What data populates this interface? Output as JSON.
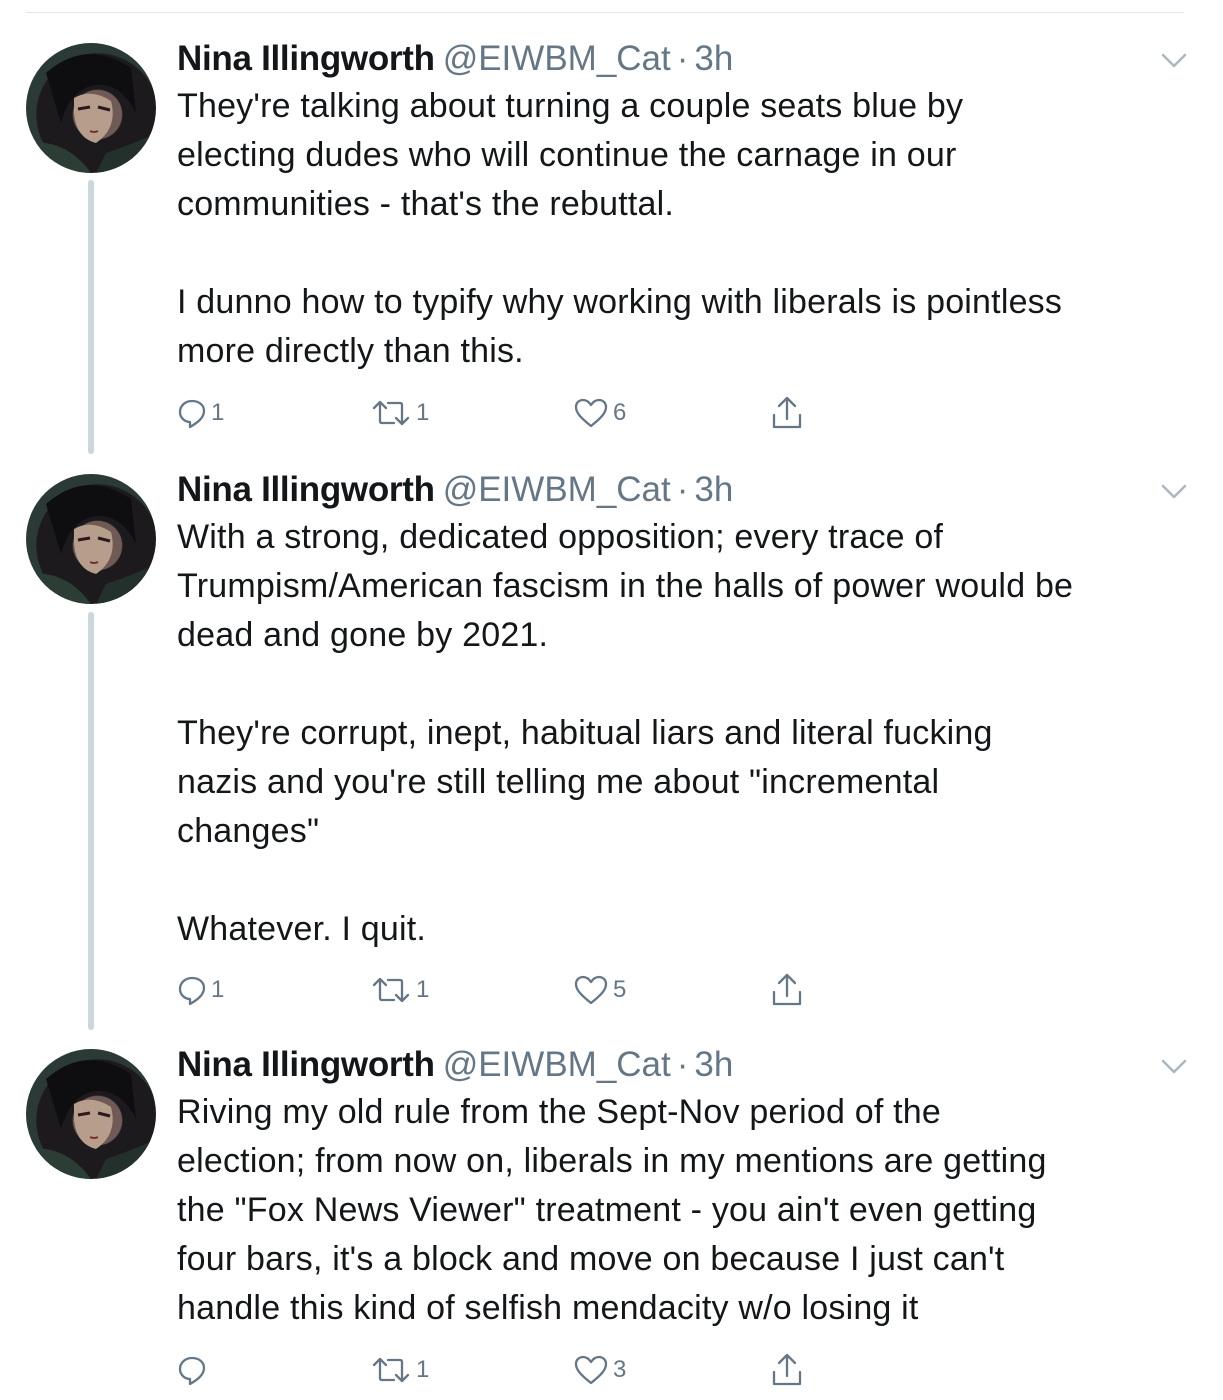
{
  "tweets": [
    {
      "author": {
        "name": "Nina Illingworth",
        "handle": "@EIWBM_Cat"
      },
      "separator": "·",
      "time": "3h",
      "text": "They're talking about turning a couple seats blue by\nelecting dudes who will continue the carnage in our\ncommunities - that's the rebuttal.\n\nI dunno how to typify why working with liberals is pointless\nmore directly than this.",
      "actions": {
        "replies": "1",
        "retweets": "1",
        "likes": "6"
      }
    },
    {
      "author": {
        "name": "Nina Illingworth",
        "handle": "@EIWBM_Cat"
      },
      "separator": "·",
      "time": "3h",
      "text": "With a strong, dedicated opposition; every trace of\nTrumpism/American fascism in the halls of power would be\ndead and gone by 2021.\n\nThey're corrupt, inept, habitual liars and literal fucking\nnazis and you're still telling me about \"incremental\nchanges\"\n\nWhatever. I quit.",
      "actions": {
        "replies": "1",
        "retweets": "1",
        "likes": "5"
      }
    },
    {
      "author": {
        "name": "Nina Illingworth",
        "handle": "@EIWBM_Cat"
      },
      "separator": "·",
      "time": "3h",
      "text": "Riving my old rule from the Sept-Nov period of the\nelection; from now on, liberals in my mentions are getting\nthe \"Fox News Viewer\" treatment - you ain't even getting\nfour bars, it's a block and move on because I just can't\nhandle this kind of selfish mendacity w/o losing it",
      "actions": {
        "replies": "",
        "retweets": "1",
        "likes": "3"
      }
    }
  ],
  "icons": {
    "reply": "reply-icon",
    "retweet": "retweet-icon",
    "like": "heart-icon",
    "share": "share-icon",
    "menu": "chevron-down-icon"
  },
  "colors": {
    "text": "#14171a",
    "muted": "#657786",
    "thread_line": "#ccd6dd",
    "divider": "#e1e8ed"
  }
}
